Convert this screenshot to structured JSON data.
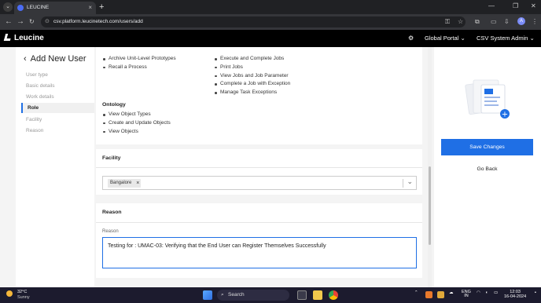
{
  "browser": {
    "tab_title": "LEUCINE",
    "tab_close": "×",
    "new_tab": "+",
    "menu_icon": "chevron-down-icon",
    "window_controls": [
      "—",
      "❐",
      "✕"
    ],
    "nav": [
      "←",
      "→",
      "C"
    ],
    "url": "csv.platform.leucinetech.com/users/add",
    "omni_icon": "⊙",
    "toolbar_icons": [
      "⚿",
      "☆",
      "⧉",
      "▭"
    ],
    "profile_letter": "A",
    "menu_dots": "⋮"
  },
  "app": {
    "logo_text": "Leucine",
    "settings_icon": "⚙",
    "portal_label": "Global Portal",
    "user_label": "CSV System Admin",
    "caret": "⌄"
  },
  "left_nav": {
    "title": "Add New User",
    "back_icon": "‹",
    "steps": [
      {
        "label": "User type",
        "active": false
      },
      {
        "label": "Basic details",
        "active": false
      },
      {
        "label": "Work details",
        "active": false
      },
      {
        "label": "Role",
        "active": true
      },
      {
        "label": "Facility",
        "active": false
      },
      {
        "label": "Reason",
        "active": false
      }
    ]
  },
  "permissions": {
    "col1_items": [
      "Archive Unit-Level Prototypes",
      "Recall a Process"
    ],
    "col2_items": [
      "Execute and Complete Jobs",
      "Print Jobs",
      "View Jobs and Job Parameter",
      "Complete a Job with Exception",
      "Manage Task Exceptions"
    ],
    "ontology_title": "Ontology",
    "ontology_items": [
      "View Object Types",
      "Create and Update Objects",
      "View Objects"
    ]
  },
  "facility": {
    "section_title": "Facility",
    "selected_chip": "Bangalore",
    "chip_remove": "×",
    "dropdown_arrow": "⌄"
  },
  "reason": {
    "section_title": "Reason",
    "field_label": "Reason",
    "value": "Testing for : UMAC-03: Verifying that the End User can Register Themselves Successfully"
  },
  "actions": {
    "save_label": "Save Changes",
    "back_label": "Go Back",
    "add_icon": "+"
  },
  "taskbar": {
    "temperature": "32°C",
    "condition": "Sunny",
    "search_label": "Search",
    "search_icon": "⌕",
    "lang_top": "ENG",
    "lang_bottom": "IN",
    "time": "12:03",
    "date": "16-04-2024",
    "start_icon": "windows-start-icon"
  },
  "colors": {
    "accent": "#1f6fe5",
    "header_bg": "#000000",
    "taskbar_bg": "#1c1b2e"
  }
}
